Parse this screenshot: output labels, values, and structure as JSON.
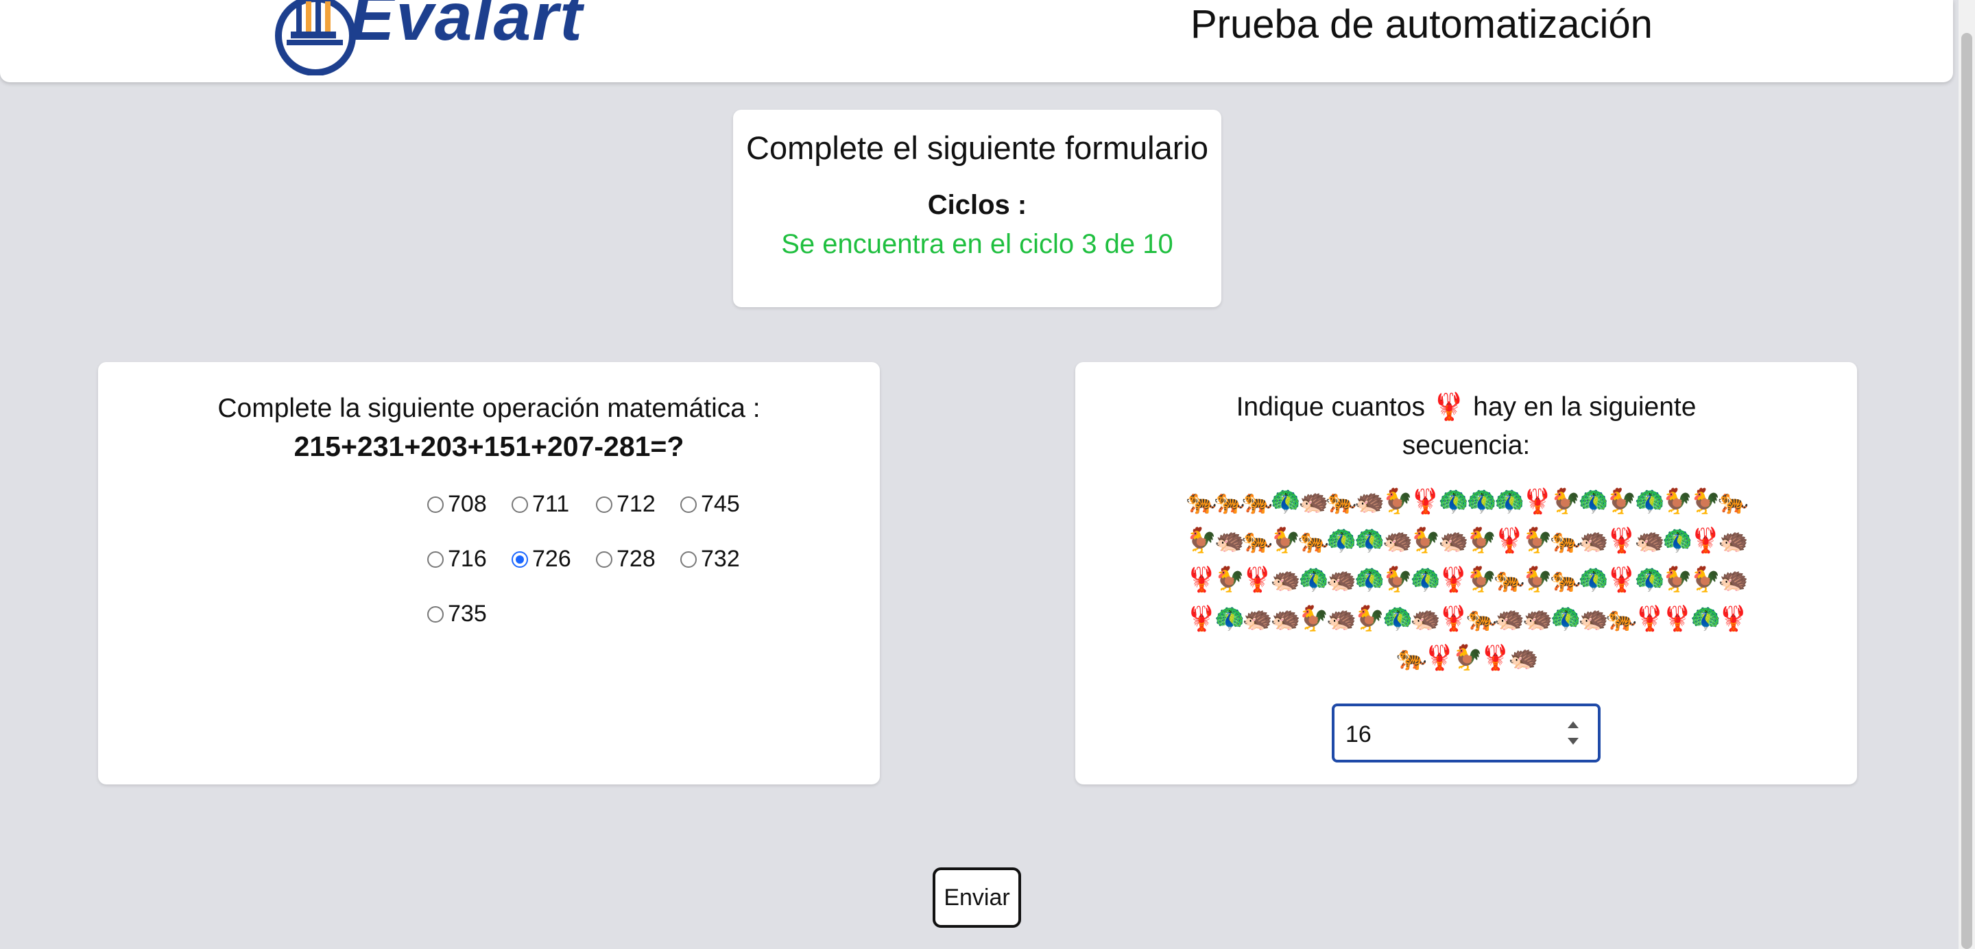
{
  "header": {
    "logo_text": "Evalart",
    "title": "Prueba de automatización"
  },
  "cycle_card": {
    "title": "Complete el siguiente formulario",
    "label": "Ciclos :",
    "status": "Se encuentra en el ciclo 3 de 10"
  },
  "math_card": {
    "prompt": "Complete la siguiente operación matemática :",
    "expression": "215+231+203+151+207-281=?",
    "options": [
      "708",
      "711",
      "712",
      "745",
      "716",
      "726",
      "728",
      "732",
      "735"
    ],
    "selected": "726"
  },
  "count_card": {
    "prompt": "Indique cuantos 🦞 hay en la siguiente secuencia:",
    "sequence": "🐅🐅🐅🦚🦔🐅🦔🐓🦞🦚🦚🦚🦞🐓🦚🐓🦚🐓🐓🐅🐓🦔🐅🐓🐅🦚🦚🦔🐓🦔🐓🦞🐓🐅🦔🦞🦔🦚🦞🦔🦞🐓🦞🦔🦚🦔🦚🐓🦚🦞🐓🐅🐓🐅🦚🦞🦚🐓🐓🦔🦞🦚🦔🦔🐓🦔🐓🦚🦔🦞🐅🦔🦔🦚🦔🐅🦞🦞🦚🦞🐅🦞🐓🦞🦔",
    "answer_value": "16"
  },
  "submit_label": "Enviar"
}
